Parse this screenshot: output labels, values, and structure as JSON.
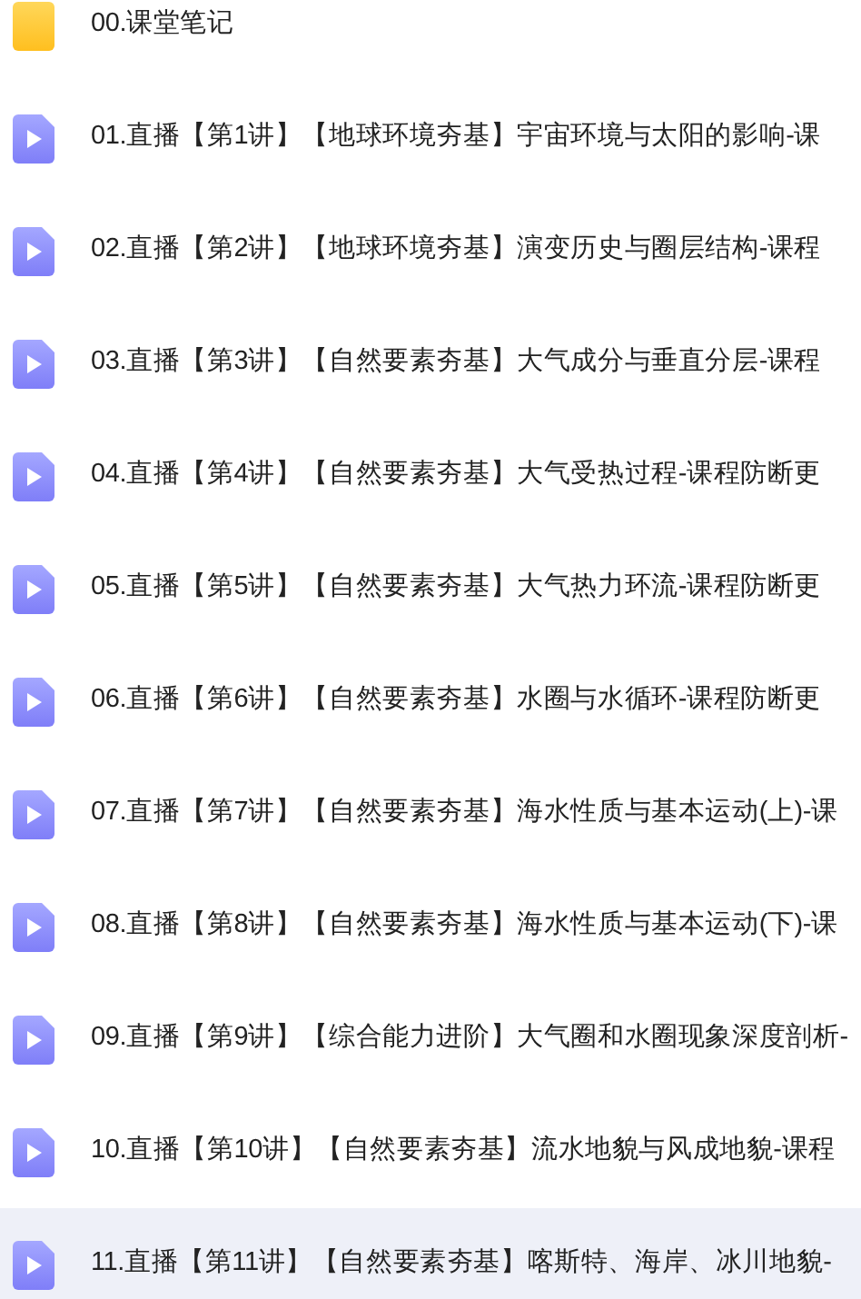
{
  "files": [
    {
      "kind": "folder",
      "name": "00.课堂笔记",
      "selected": false
    },
    {
      "kind": "video",
      "name": "01.直播【第1讲】【地球环境夯基】宇宙环境与太阳的影响-课",
      "selected": false
    },
    {
      "kind": "video",
      "name": "02.直播【第2讲】【地球环境夯基】演变历史与圈层结构-课程",
      "selected": false
    },
    {
      "kind": "video",
      "name": "03.直播【第3讲】【自然要素夯基】大气成分与垂直分层-课程",
      "selected": false
    },
    {
      "kind": "video",
      "name": "04.直播【第4讲】【自然要素夯基】大气受热过程-课程防断更",
      "selected": false
    },
    {
      "kind": "video",
      "name": "05.直播【第5讲】【自然要素夯基】大气热力环流-课程防断更",
      "selected": false
    },
    {
      "kind": "video",
      "name": "06.直播【第6讲】【自然要素夯基】水圈与水循环-课程防断更",
      "selected": false
    },
    {
      "kind": "video",
      "name": "07.直播【第7讲】【自然要素夯基】海水性质与基本运动(上)-课",
      "selected": false
    },
    {
      "kind": "video",
      "name": "08.直播【第8讲】【自然要素夯基】海水性质与基本运动(下)-课",
      "selected": false
    },
    {
      "kind": "video",
      "name": "09.直播【第9讲】【综合能力进阶】大气圈和水圈现象深度剖析-",
      "selected": false
    },
    {
      "kind": "video",
      "name": "10.直播【第10讲】【自然要素夯基】流水地貌与风成地貌-课程",
      "selected": false
    },
    {
      "kind": "video",
      "name": "11.直播【第11讲】【自然要素夯基】喀斯特、海岸、冰川地貌-",
      "selected": true
    }
  ]
}
